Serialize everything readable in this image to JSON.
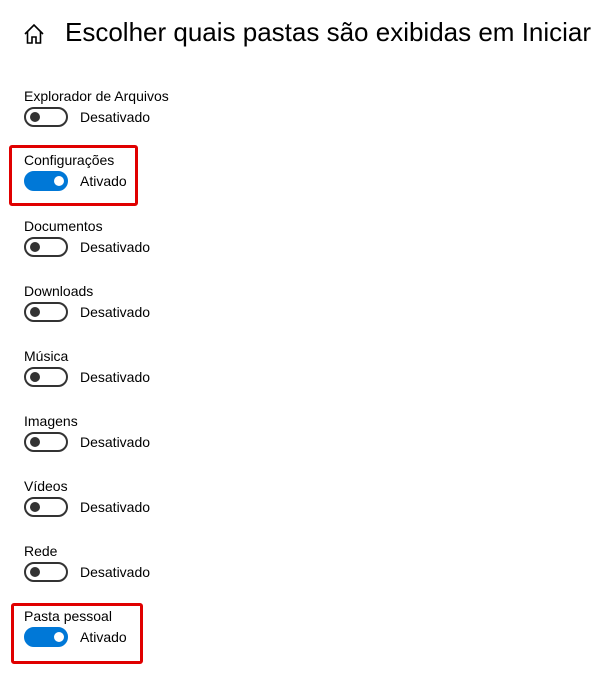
{
  "header": {
    "home_icon": "home-icon",
    "title": "Escolher quais pastas são exibidas em Iniciar"
  },
  "colors": {
    "accent": "#0078d7",
    "highlight": "#e00000"
  },
  "settings": [
    {
      "label": "Explorador de Arquivos",
      "state": "Desativado",
      "on": false,
      "highlighted": false
    },
    {
      "label": "Configurações",
      "state": "Ativado",
      "on": true,
      "highlighted": true
    },
    {
      "label": "Documentos",
      "state": "Desativado",
      "on": false,
      "highlighted": false
    },
    {
      "label": "Downloads",
      "state": "Desativado",
      "on": false,
      "highlighted": false
    },
    {
      "label": "Música",
      "state": "Desativado",
      "on": false,
      "highlighted": false
    },
    {
      "label": "Imagens",
      "state": "Desativado",
      "on": false,
      "highlighted": false
    },
    {
      "label": "Vídeos",
      "state": "Desativado",
      "on": false,
      "highlighted": false
    },
    {
      "label": "Rede",
      "state": "Desativado",
      "on": false,
      "highlighted": false
    },
    {
      "label": "Pasta pessoal",
      "state": "Ativado",
      "on": true,
      "highlighted": true
    }
  ]
}
